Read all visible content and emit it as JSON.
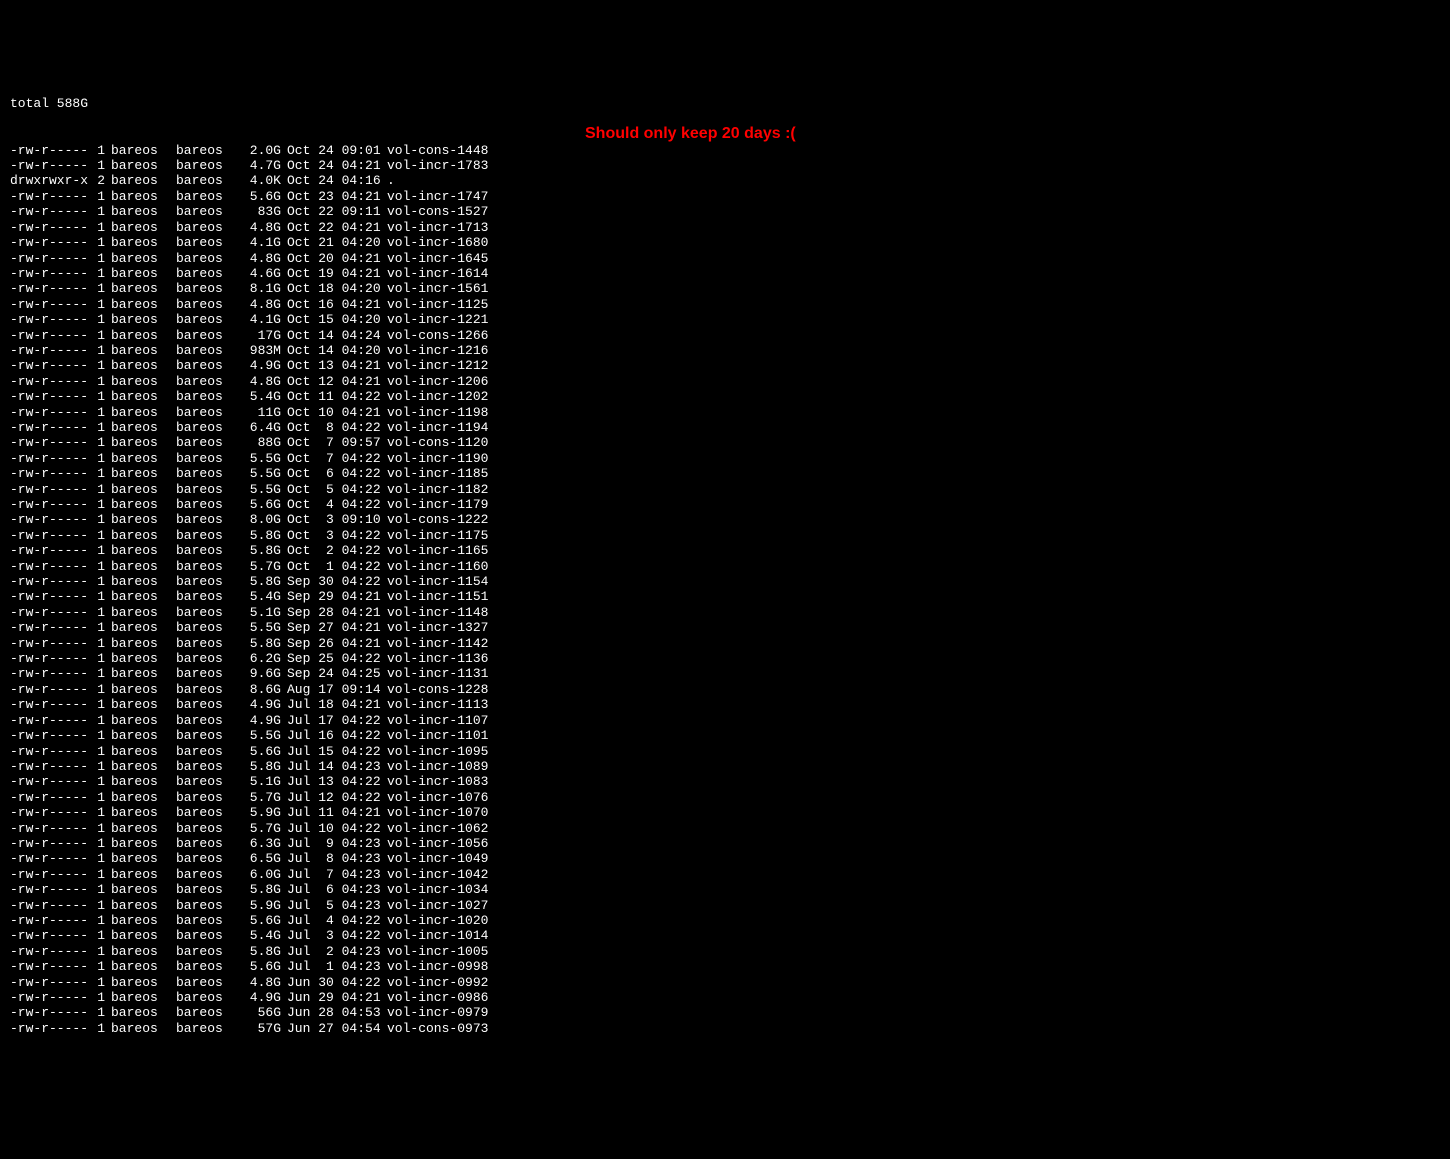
{
  "total_line": "total 588G",
  "annotation": "Should only keep 20 days :(",
  "rows": [
    {
      "perms": "-rw-r-----",
      "links": "1",
      "owner": "bareos",
      "group": "bareos",
      "size": "2.0G",
      "date": "Oct 24 09:01",
      "name": "vol-cons-1448"
    },
    {
      "perms": "-rw-r-----",
      "links": "1",
      "owner": "bareos",
      "group": "bareos",
      "size": "4.7G",
      "date": "Oct 24 04:21",
      "name": "vol-incr-1783"
    },
    {
      "perms": "drwxrwxr-x",
      "links": "2",
      "owner": "bareos",
      "group": "bareos",
      "size": "4.0K",
      "date": "Oct 24 04:16",
      "name": "."
    },
    {
      "perms": "-rw-r-----",
      "links": "1",
      "owner": "bareos",
      "group": "bareos",
      "size": "5.6G",
      "date": "Oct 23 04:21",
      "name": "vol-incr-1747"
    },
    {
      "perms": "-rw-r-----",
      "links": "1",
      "owner": "bareos",
      "group": "bareos",
      "size": "83G",
      "date": "Oct 22 09:11",
      "name": "vol-cons-1527"
    },
    {
      "perms": "-rw-r-----",
      "links": "1",
      "owner": "bareos",
      "group": "bareos",
      "size": "4.8G",
      "date": "Oct 22 04:21",
      "name": "vol-incr-1713"
    },
    {
      "perms": "-rw-r-----",
      "links": "1",
      "owner": "bareos",
      "group": "bareos",
      "size": "4.1G",
      "date": "Oct 21 04:20",
      "name": "vol-incr-1680"
    },
    {
      "perms": "-rw-r-----",
      "links": "1",
      "owner": "bareos",
      "group": "bareos",
      "size": "4.8G",
      "date": "Oct 20 04:21",
      "name": "vol-incr-1645"
    },
    {
      "perms": "-rw-r-----",
      "links": "1",
      "owner": "bareos",
      "group": "bareos",
      "size": "4.6G",
      "date": "Oct 19 04:21",
      "name": "vol-incr-1614"
    },
    {
      "perms": "-rw-r-----",
      "links": "1",
      "owner": "bareos",
      "group": "bareos",
      "size": "8.1G",
      "date": "Oct 18 04:20",
      "name": "vol-incr-1561"
    },
    {
      "perms": "-rw-r-----",
      "links": "1",
      "owner": "bareos",
      "group": "bareos",
      "size": "4.8G",
      "date": "Oct 16 04:21",
      "name": "vol-incr-1125"
    },
    {
      "perms": "-rw-r-----",
      "links": "1",
      "owner": "bareos",
      "group": "bareos",
      "size": "4.1G",
      "date": "Oct 15 04:20",
      "name": "vol-incr-1221"
    },
    {
      "perms": "-rw-r-----",
      "links": "1",
      "owner": "bareos",
      "group": "bareos",
      "size": "17G",
      "date": "Oct 14 04:24",
      "name": "vol-cons-1266"
    },
    {
      "perms": "-rw-r-----",
      "links": "1",
      "owner": "bareos",
      "group": "bareos",
      "size": "983M",
      "date": "Oct 14 04:20",
      "name": "vol-incr-1216"
    },
    {
      "perms": "-rw-r-----",
      "links": "1",
      "owner": "bareos",
      "group": "bareos",
      "size": "4.9G",
      "date": "Oct 13 04:21",
      "name": "vol-incr-1212"
    },
    {
      "perms": "-rw-r-----",
      "links": "1",
      "owner": "bareos",
      "group": "bareos",
      "size": "4.8G",
      "date": "Oct 12 04:21",
      "name": "vol-incr-1206"
    },
    {
      "perms": "-rw-r-----",
      "links": "1",
      "owner": "bareos",
      "group": "bareos",
      "size": "5.4G",
      "date": "Oct 11 04:22",
      "name": "vol-incr-1202"
    },
    {
      "perms": "-rw-r-----",
      "links": "1",
      "owner": "bareos",
      "group": "bareos",
      "size": "11G",
      "date": "Oct 10 04:21",
      "name": "vol-incr-1198"
    },
    {
      "perms": "-rw-r-----",
      "links": "1",
      "owner": "bareos",
      "group": "bareos",
      "size": "6.4G",
      "date": "Oct  8 04:22",
      "name": "vol-incr-1194"
    },
    {
      "perms": "-rw-r-----",
      "links": "1",
      "owner": "bareos",
      "group": "bareos",
      "size": "88G",
      "date": "Oct  7 09:57",
      "name": "vol-cons-1120"
    },
    {
      "perms": "-rw-r-----",
      "links": "1",
      "owner": "bareos",
      "group": "bareos",
      "size": "5.5G",
      "date": "Oct  7 04:22",
      "name": "vol-incr-1190"
    },
    {
      "perms": "-rw-r-----",
      "links": "1",
      "owner": "bareos",
      "group": "bareos",
      "size": "5.5G",
      "date": "Oct  6 04:22",
      "name": "vol-incr-1185"
    },
    {
      "perms": "-rw-r-----",
      "links": "1",
      "owner": "bareos",
      "group": "bareos",
      "size": "5.5G",
      "date": "Oct  5 04:22",
      "name": "vol-incr-1182"
    },
    {
      "perms": "-rw-r-----",
      "links": "1",
      "owner": "bareos",
      "group": "bareos",
      "size": "5.6G",
      "date": "Oct  4 04:22",
      "name": "vol-incr-1179"
    },
    {
      "perms": "-rw-r-----",
      "links": "1",
      "owner": "bareos",
      "group": "bareos",
      "size": "8.0G",
      "date": "Oct  3 09:10",
      "name": "vol-cons-1222"
    },
    {
      "perms": "-rw-r-----",
      "links": "1",
      "owner": "bareos",
      "group": "bareos",
      "size": "5.8G",
      "date": "Oct  3 04:22",
      "name": "vol-incr-1175"
    },
    {
      "perms": "-rw-r-----",
      "links": "1",
      "owner": "bareos",
      "group": "bareos",
      "size": "5.8G",
      "date": "Oct  2 04:22",
      "name": "vol-incr-1165"
    },
    {
      "perms": "-rw-r-----",
      "links": "1",
      "owner": "bareos",
      "group": "bareos",
      "size": "5.7G",
      "date": "Oct  1 04:22",
      "name": "vol-incr-1160"
    },
    {
      "perms": "-rw-r-----",
      "links": "1",
      "owner": "bareos",
      "group": "bareos",
      "size": "5.8G",
      "date": "Sep 30 04:22",
      "name": "vol-incr-1154"
    },
    {
      "perms": "-rw-r-----",
      "links": "1",
      "owner": "bareos",
      "group": "bareos",
      "size": "5.4G",
      "date": "Sep 29 04:21",
      "name": "vol-incr-1151"
    },
    {
      "perms": "-rw-r-----",
      "links": "1",
      "owner": "bareos",
      "group": "bareos",
      "size": "5.1G",
      "date": "Sep 28 04:21",
      "name": "vol-incr-1148"
    },
    {
      "perms": "-rw-r-----",
      "links": "1",
      "owner": "bareos",
      "group": "bareos",
      "size": "5.5G",
      "date": "Sep 27 04:21",
      "name": "vol-incr-1327"
    },
    {
      "perms": "-rw-r-----",
      "links": "1",
      "owner": "bareos",
      "group": "bareos",
      "size": "5.8G",
      "date": "Sep 26 04:21",
      "name": "vol-incr-1142"
    },
    {
      "perms": "-rw-r-----",
      "links": "1",
      "owner": "bareos",
      "group": "bareos",
      "size": "6.2G",
      "date": "Sep 25 04:22",
      "name": "vol-incr-1136"
    },
    {
      "perms": "-rw-r-----",
      "links": "1",
      "owner": "bareos",
      "group": "bareos",
      "size": "9.6G",
      "date": "Sep 24 04:25",
      "name": "vol-incr-1131"
    },
    {
      "perms": "-rw-r-----",
      "links": "1",
      "owner": "bareos",
      "group": "bareos",
      "size": "8.6G",
      "date": "Aug 17 09:14",
      "name": "vol-cons-1228"
    },
    {
      "perms": "-rw-r-----",
      "links": "1",
      "owner": "bareos",
      "group": "bareos",
      "size": "4.9G",
      "date": "Jul 18 04:21",
      "name": "vol-incr-1113"
    },
    {
      "perms": "-rw-r-----",
      "links": "1",
      "owner": "bareos",
      "group": "bareos",
      "size": "4.9G",
      "date": "Jul 17 04:22",
      "name": "vol-incr-1107"
    },
    {
      "perms": "-rw-r-----",
      "links": "1",
      "owner": "bareos",
      "group": "bareos",
      "size": "5.5G",
      "date": "Jul 16 04:22",
      "name": "vol-incr-1101"
    },
    {
      "perms": "-rw-r-----",
      "links": "1",
      "owner": "bareos",
      "group": "bareos",
      "size": "5.6G",
      "date": "Jul 15 04:22",
      "name": "vol-incr-1095"
    },
    {
      "perms": "-rw-r-----",
      "links": "1",
      "owner": "bareos",
      "group": "bareos",
      "size": "5.8G",
      "date": "Jul 14 04:23",
      "name": "vol-incr-1089"
    },
    {
      "perms": "-rw-r-----",
      "links": "1",
      "owner": "bareos",
      "group": "bareos",
      "size": "5.1G",
      "date": "Jul 13 04:22",
      "name": "vol-incr-1083"
    },
    {
      "perms": "-rw-r-----",
      "links": "1",
      "owner": "bareos",
      "group": "bareos",
      "size": "5.7G",
      "date": "Jul 12 04:22",
      "name": "vol-incr-1076"
    },
    {
      "perms": "-rw-r-----",
      "links": "1",
      "owner": "bareos",
      "group": "bareos",
      "size": "5.9G",
      "date": "Jul 11 04:21",
      "name": "vol-incr-1070"
    },
    {
      "perms": "-rw-r-----",
      "links": "1",
      "owner": "bareos",
      "group": "bareos",
      "size": "5.7G",
      "date": "Jul 10 04:22",
      "name": "vol-incr-1062"
    },
    {
      "perms": "-rw-r-----",
      "links": "1",
      "owner": "bareos",
      "group": "bareos",
      "size": "6.3G",
      "date": "Jul  9 04:23",
      "name": "vol-incr-1056"
    },
    {
      "perms": "-rw-r-----",
      "links": "1",
      "owner": "bareos",
      "group": "bareos",
      "size": "6.5G",
      "date": "Jul  8 04:23",
      "name": "vol-incr-1049"
    },
    {
      "perms": "-rw-r-----",
      "links": "1",
      "owner": "bareos",
      "group": "bareos",
      "size": "6.0G",
      "date": "Jul  7 04:23",
      "name": "vol-incr-1042"
    },
    {
      "perms": "-rw-r-----",
      "links": "1",
      "owner": "bareos",
      "group": "bareos",
      "size": "5.8G",
      "date": "Jul  6 04:23",
      "name": "vol-incr-1034"
    },
    {
      "perms": "-rw-r-----",
      "links": "1",
      "owner": "bareos",
      "group": "bareos",
      "size": "5.9G",
      "date": "Jul  5 04:23",
      "name": "vol-incr-1027"
    },
    {
      "perms": "-rw-r-----",
      "links": "1",
      "owner": "bareos",
      "group": "bareos",
      "size": "5.6G",
      "date": "Jul  4 04:22",
      "name": "vol-incr-1020"
    },
    {
      "perms": "-rw-r-----",
      "links": "1",
      "owner": "bareos",
      "group": "bareos",
      "size": "5.4G",
      "date": "Jul  3 04:22",
      "name": "vol-incr-1014"
    },
    {
      "perms": "-rw-r-----",
      "links": "1",
      "owner": "bareos",
      "group": "bareos",
      "size": "5.8G",
      "date": "Jul  2 04:23",
      "name": "vol-incr-1005"
    },
    {
      "perms": "-rw-r-----",
      "links": "1",
      "owner": "bareos",
      "group": "bareos",
      "size": "5.6G",
      "date": "Jul  1 04:23",
      "name": "vol-incr-0998"
    },
    {
      "perms": "-rw-r-----",
      "links": "1",
      "owner": "bareos",
      "group": "bareos",
      "size": "4.8G",
      "date": "Jun 30 04:22",
      "name": "vol-incr-0992"
    },
    {
      "perms": "-rw-r-----",
      "links": "1",
      "owner": "bareos",
      "group": "bareos",
      "size": "4.9G",
      "date": "Jun 29 04:21",
      "name": "vol-incr-0986"
    },
    {
      "perms": "-rw-r-----",
      "links": "1",
      "owner": "bareos",
      "group": "bareos",
      "size": "56G",
      "date": "Jun 28 04:53",
      "name": "vol-incr-0979"
    },
    {
      "perms": "-rw-r-----",
      "links": "1",
      "owner": "bareos",
      "group": "bareos",
      "size": "57G",
      "date": "Jun 27 04:54",
      "name": "vol-cons-0973"
    }
  ]
}
